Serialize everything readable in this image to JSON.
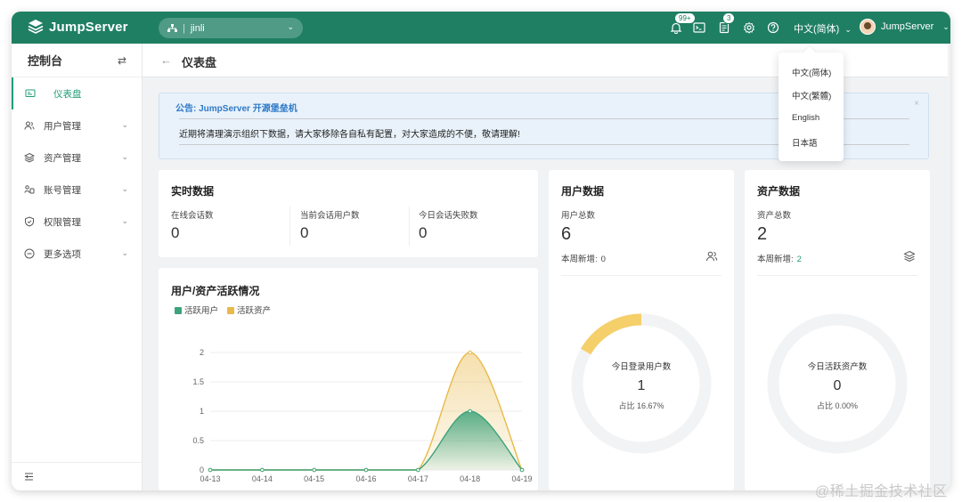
{
  "header": {
    "brand": "JumpServer",
    "org_icon": "org-icon",
    "org_name": "jinli",
    "notifications_badge": "99+",
    "tickets_badge": "3",
    "language": "中文(简体)",
    "username": "JumpServer"
  },
  "sidebar": {
    "title": "控制台",
    "items": [
      {
        "label": "仪表盘",
        "icon": "dashboard-icon"
      },
      {
        "label": "用户管理",
        "icon": "users-icon"
      },
      {
        "label": "资产管理",
        "icon": "assets-icon"
      },
      {
        "label": "账号管理",
        "icon": "accounts-icon"
      },
      {
        "label": "权限管理",
        "icon": "permissions-icon"
      },
      {
        "label": "更多选项",
        "icon": "more-icon"
      }
    ]
  },
  "page": {
    "title": "仪表盘"
  },
  "notice": {
    "title": "公告: JumpServer 开源堡垒机",
    "text": "近期将清理演示组织下数据，请大家移除各自私有配置，对大家造成的不便，敬请理解!"
  },
  "realtime": {
    "title": "实时数据",
    "stats": [
      {
        "label": "在线会话数",
        "value": "0"
      },
      {
        "label": "当前会话用户数",
        "value": "0"
      },
      {
        "label": "今日会话失败数",
        "value": "0"
      }
    ]
  },
  "user_data": {
    "title": "用户数据",
    "total_label": "用户总数",
    "total": "6",
    "new_label": "本周新增:",
    "new_value": "0",
    "donut_label": "今日登录用户数",
    "donut_value": "1",
    "donut_ratio_text": "占比 16.67%",
    "donut_fraction": 0.1667
  },
  "asset_data": {
    "title": "资产数据",
    "total_label": "资产总数",
    "total": "2",
    "new_label": "本周新增:",
    "new_value": "2",
    "donut_label": "今日活跃资产数",
    "donut_value": "0",
    "donut_ratio_text": "占比 0.00%",
    "donut_fraction": 0
  },
  "activity": {
    "title": "用户/资产活跃情况"
  },
  "chart_data": {
    "type": "area",
    "title": "用户/资产活跃情况",
    "x": [
      "04-13",
      "04-14",
      "04-15",
      "04-16",
      "04-17",
      "04-18",
      "04-19"
    ],
    "series": [
      {
        "name": "活跃用户",
        "values": [
          0,
          0,
          0,
          0,
          0,
          1,
          0
        ],
        "color": "#3da37c"
      },
      {
        "name": "活跃资产",
        "values": [
          0,
          0,
          0,
          0,
          0,
          2,
          0
        ],
        "color": "#e9b949"
      }
    ],
    "y_ticks": [
      "0",
      "0.5",
      "1",
      "1.5",
      "2"
    ],
    "ylim": [
      0,
      2
    ],
    "grid": true,
    "legend": "top-left"
  },
  "lang_menu": {
    "options": [
      "中文(简体)",
      "中文(繁體)",
      "English",
      "日本語"
    ]
  },
  "watermark": "@稀土掘金技术社区",
  "colors": {
    "brand": "#1f7f63",
    "accent": "#1f9d78",
    "user_series": "#3da37c",
    "asset_series": "#e9b949"
  }
}
